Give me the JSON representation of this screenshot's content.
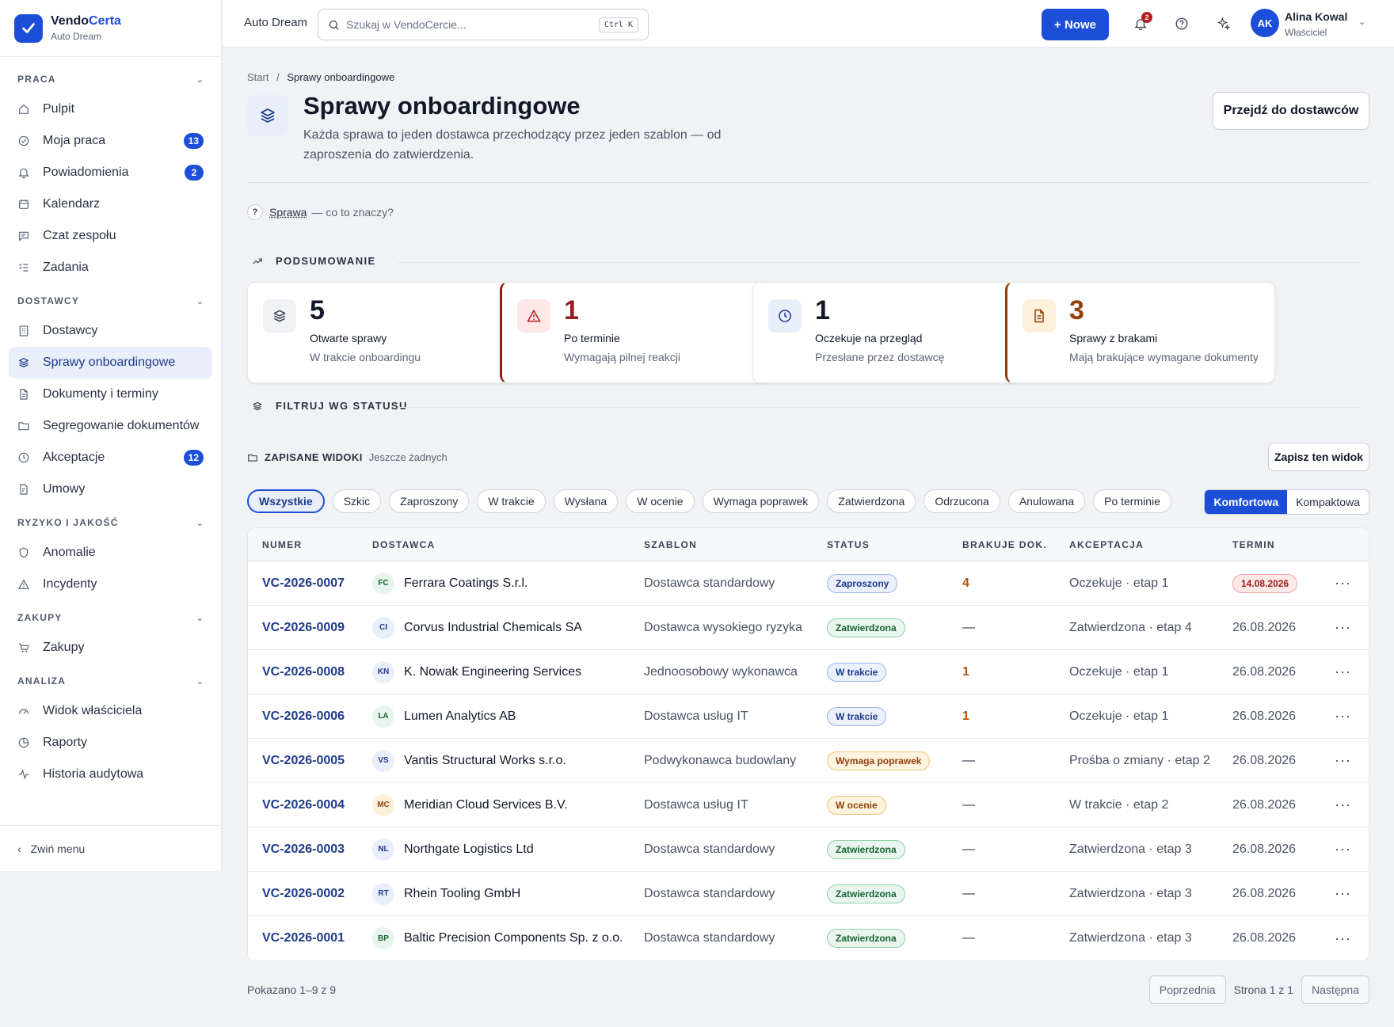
{
  "brand": {
    "name_a": "Vendo",
    "name_b": "Certa",
    "workspace": "Auto Dream"
  },
  "sidebar": {
    "sections": [
      {
        "title": "PRACA",
        "items": [
          {
            "label": "Pulpit",
            "icon": "home-icon"
          },
          {
            "label": "Moja praca",
            "icon": "check-circle-icon",
            "count": "13"
          },
          {
            "label": "Powiadomienia",
            "icon": "bell-icon",
            "count": "2"
          },
          {
            "label": "Kalendarz",
            "icon": "calendar-icon"
          },
          {
            "label": "Czat zespołu",
            "icon": "chat-icon"
          },
          {
            "label": "Zadania",
            "icon": "checklist-icon"
          }
        ]
      },
      {
        "title": "DOSTAWCY",
        "items": [
          {
            "label": "Dostawcy",
            "icon": "building-icon"
          },
          {
            "label": "Sprawy onboardingowe",
            "icon": "layers-icon",
            "active": true
          },
          {
            "label": "Dokumenty i terminy",
            "icon": "document-icon"
          },
          {
            "label": "Segregowanie dokumentów",
            "icon": "folder-icon"
          },
          {
            "label": "Akceptacje",
            "icon": "clock-icon",
            "count": "12"
          },
          {
            "label": "Umowy",
            "icon": "contract-icon"
          }
        ]
      },
      {
        "title": "RYZYKO I JAKOŚĆ",
        "items": [
          {
            "label": "Anomalie",
            "icon": "shield-icon"
          },
          {
            "label": "Incydenty",
            "icon": "warning-icon"
          }
        ]
      },
      {
        "title": "ZAKUPY",
        "items": [
          {
            "label": "Zakupy",
            "icon": "cart-icon"
          }
        ]
      },
      {
        "title": "ANALIZA",
        "items": [
          {
            "label": "Widok właściciela",
            "icon": "gauge-icon"
          },
          {
            "label": "Raporty",
            "icon": "pie-chart-icon"
          },
          {
            "label": "Historia audytowa",
            "icon": "activity-icon"
          }
        ]
      }
    ],
    "collapse_label": "Zwiń menu"
  },
  "topbar": {
    "workspace": "Auto Dream",
    "search_placeholder": "Szukaj w VendoCercie...",
    "search_shortcut": "Ctrl K",
    "new_label": "+ Nowe",
    "notif_count": "2",
    "user_initials": "AK",
    "user_name": "Alina Kowal",
    "user_role": "Właściciel"
  },
  "page": {
    "breadcrumb_home": "Start",
    "breadcrumb_sep": "/",
    "breadcrumb_current": "Sprawy onboardingowe",
    "title": "Sprawy onboardingowe",
    "description": "Każda sprawa to jeden dostawca przechodzący przez jeden szablon — od zaproszenia do zatwierdzenia.",
    "go_button": "Przejdź do dostawców",
    "help_term": "Sprawa",
    "help_text": "— co to znaczy?"
  },
  "summary": {
    "title": "PODSUMOWANIE",
    "cards": [
      {
        "value": "5",
        "label": "Otwarte sprawy",
        "sub": "W trakcie onboardingu",
        "color": "#111827"
      },
      {
        "value": "1",
        "label": "Po terminie",
        "sub": "Wymagają pilnej reakcji",
        "color": "#991b1b"
      },
      {
        "value": "1",
        "label": "Oczekuje na przegląd",
        "sub": "Przesłane przez dostawcę",
        "color": "#111827"
      },
      {
        "value": "3",
        "label": "Sprawy z brakami",
        "sub": "Mają brakujące wymagane dokumenty",
        "color": "#92400e"
      }
    ]
  },
  "filter": {
    "title": "FILTRUJ WG STATUSU",
    "saved_label": "ZAPISANE WIDOKI",
    "saved_empty": "Jeszcze żadnych",
    "save_button": "Zapisz ten widok",
    "chips": [
      "Wszystkie",
      "Szkic",
      "Zaproszony",
      "W trakcie",
      "Wysłana",
      "W ocenie",
      "Wymaga poprawek",
      "Zatwierdzona",
      "Odrzucona",
      "Anulowana",
      "Po terminie"
    ],
    "density": [
      "Komfortowa",
      "Kompaktowa"
    ]
  },
  "table": {
    "columns": [
      "NUMER",
      "DOSTAWCA",
      "SZABLON",
      "STATUS",
      "BRAKUJE DOK.",
      "AKCEPTACJA",
      "TERMIN"
    ],
    "rows": [
      {
        "num": "VC-2026-0007",
        "ini": "FC",
        "sup": "Ferrara Coatings S.r.l.",
        "tpl": "Dostawca standardowy",
        "status": "Zaproszony",
        "missing": "4",
        "acc": "Oczekuje · etap 1",
        "due": "14.08.2026"
      },
      {
        "num": "VC-2026-0009",
        "ini": "CI",
        "sup": "Corvus Industrial Chemicals SA",
        "tpl": "Dostawca wysokiego ryzyka",
        "status": "Zatwierdzona",
        "missing": "—",
        "acc": "Zatwierdzona · etap 4",
        "due": "26.08.2026"
      },
      {
        "num": "VC-2026-0008",
        "ini": "KN",
        "sup": "K. Nowak Engineering Services",
        "tpl": "Jednoosobowy wykonawca",
        "status": "W trakcie",
        "missing": "1",
        "acc": "Oczekuje · etap 1",
        "due": "26.08.2026"
      },
      {
        "num": "VC-2026-0006",
        "ini": "LA",
        "sup": "Lumen Analytics AB",
        "tpl": "Dostawca usług IT",
        "status": "W trakcie",
        "missing": "1",
        "acc": "Oczekuje · etap 1",
        "due": "26.08.2026"
      },
      {
        "num": "VC-2026-0005",
        "ini": "VS",
        "sup": "Vantis Structural Works s.r.o.",
        "tpl": "Podwykonawca budowlany",
        "status": "Wymaga poprawek",
        "missing": "—",
        "acc": "Prośba o zmiany · etap 2",
        "due": "26.08.2026"
      },
      {
        "num": "VC-2026-0004",
        "ini": "MC",
        "sup": "Meridian Cloud Services B.V.",
        "tpl": "Dostawca usług IT",
        "status": "W ocenie",
        "missing": "—",
        "acc": "W trakcie · etap 2",
        "due": "26.08.2026"
      },
      {
        "num": "VC-2026-0003",
        "ini": "NL",
        "sup": "Northgate Logistics Ltd",
        "tpl": "Dostawca standardowy",
        "status": "Zatwierdzona",
        "missing": "—",
        "acc": "Zatwierdzona · etap 3",
        "due": "26.08.2026"
      },
      {
        "num": "VC-2026-0002",
        "ini": "RT",
        "sup": "Rhein Tooling GmbH",
        "tpl": "Dostawca standardowy",
        "status": "Zatwierdzona",
        "missing": "—",
        "acc": "Zatwierdzona · etap 3",
        "due": "26.08.2026"
      },
      {
        "num": "VC-2026-0001",
        "ini": "BP",
        "sup": "Baltic Precision Components Sp. z o.o.",
        "tpl": "Dostawca standardowy",
        "status": "Zatwierdzona",
        "missing": "—",
        "acc": "Zatwierdzona · etap 3",
        "due": "26.08.2026"
      }
    ]
  },
  "pagination": {
    "shown": "Pokazano 1–9 z 9",
    "prev": "Poprzednia",
    "info": "Strona 1 z 1",
    "next": "Następna"
  },
  "colors": {
    "accent": "#1d4ed8",
    "danger": "#991b1b",
    "warning": "#92400e"
  }
}
